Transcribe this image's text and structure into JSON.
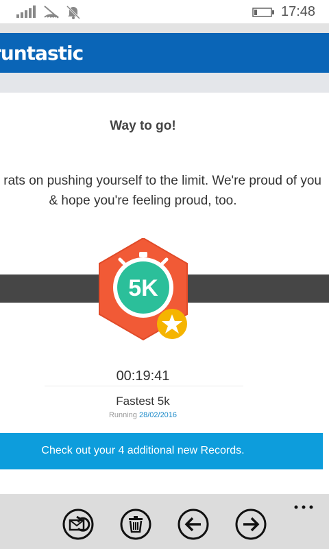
{
  "status_bar": {
    "time": "17:48",
    "icons": [
      "signal-icon",
      "wifi-icon",
      "quiet-hours-icon",
      "battery-icon"
    ]
  },
  "header": {
    "logo_text": "runtastic",
    "color": "#0a65b7"
  },
  "email": {
    "title": "Way to go!",
    "message_line1": "rats on pushing yourself to the limit. We're proud of you",
    "message_line2": "& hope you're feeling proud, too.",
    "badge": {
      "label": "5K",
      "icons": [
        "stopwatch-icon",
        "star-icon"
      ]
    },
    "record": {
      "time": "00:19:41",
      "name": "Fastest 5k",
      "activity": "Running",
      "date": "28/02/2016"
    },
    "cta_label": "Check out your 4 additional new Records."
  },
  "app_bar": {
    "buttons": [
      "reply-icon",
      "delete-icon",
      "previous-icon",
      "next-icon"
    ],
    "more_label": "more"
  },
  "colors": {
    "accent": "#0d9ddc",
    "badge_orange": "#f15a36",
    "badge_teal": "#2bbf9a",
    "star_yellow": "#f5b400",
    "band": "#464646"
  }
}
